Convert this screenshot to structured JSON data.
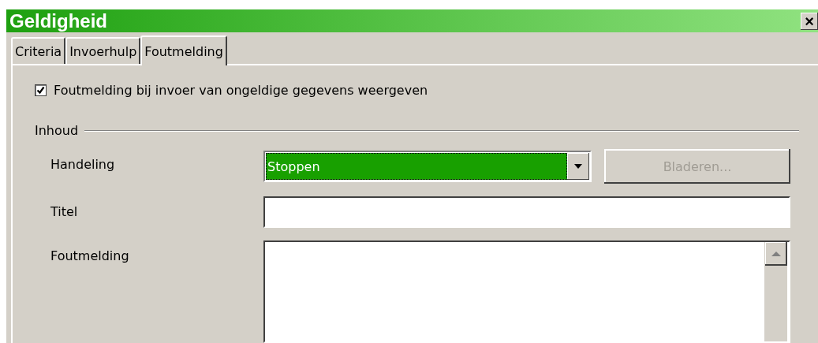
{
  "window": {
    "title": "Geldigheid",
    "close": "×"
  },
  "tabs": [
    {
      "label": "Criteria",
      "selected": false
    },
    {
      "label": "Invoerhulp",
      "selected": false
    },
    {
      "label": "Foutmelding",
      "selected": true
    }
  ],
  "show_error": {
    "label": "Foutmelding bij invoer van ongeldige gegevens weergeven",
    "checked": true
  },
  "content": {
    "heading": "Inhoud",
    "action": {
      "label": "Handeling",
      "value": "Stoppen",
      "browse": {
        "label": "Bladeren...",
        "disabled": true
      }
    },
    "title": {
      "label": "Titel"
    },
    "message": {
      "label": "Foutmelding"
    }
  }
}
